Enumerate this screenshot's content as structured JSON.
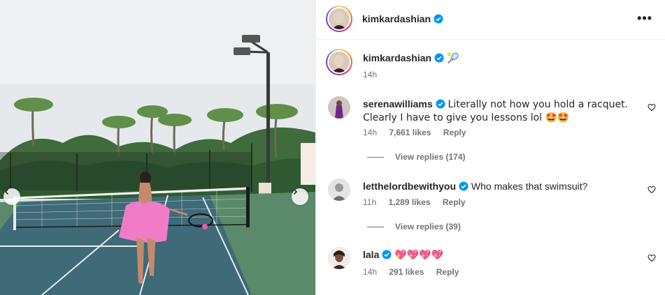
{
  "post": {
    "author": "kimkardashian",
    "verified": true
  },
  "caption": {
    "username": "kimkardashian",
    "text": "🎾 ",
    "time": "14h"
  },
  "comments": [
    {
      "username": "serenawilliams",
      "text": "Literally not how you hold a racquet. Clearly I have to give you lessons lol 🤩🤩",
      "time": "14h",
      "likes": "7,661 likes",
      "reply": "Reply",
      "view_replies": "View replies (174)"
    },
    {
      "username": "letthelordbewithyou",
      "text": "Who makes that swimsuit?",
      "time": "11h",
      "likes": "1,289 likes",
      "reply": "Reply",
      "view_replies": "View replies (39)"
    },
    {
      "username": "lala",
      "text": "💖💖💖💖",
      "time": "14h",
      "likes": "291 likes",
      "reply": "Reply"
    }
  ],
  "icons": {
    "more": "more-options-icon",
    "verified": "verified-badge-icon",
    "like": "heart-icon",
    "prev": "chevron-left-icon",
    "next": "chevron-right-icon"
  },
  "colors": {
    "verified": "#0095f6",
    "muted": "#737373",
    "court_green": "#5b8a6b",
    "court_blue": "#3f6a78",
    "robe_pink": "#f07cc8"
  }
}
